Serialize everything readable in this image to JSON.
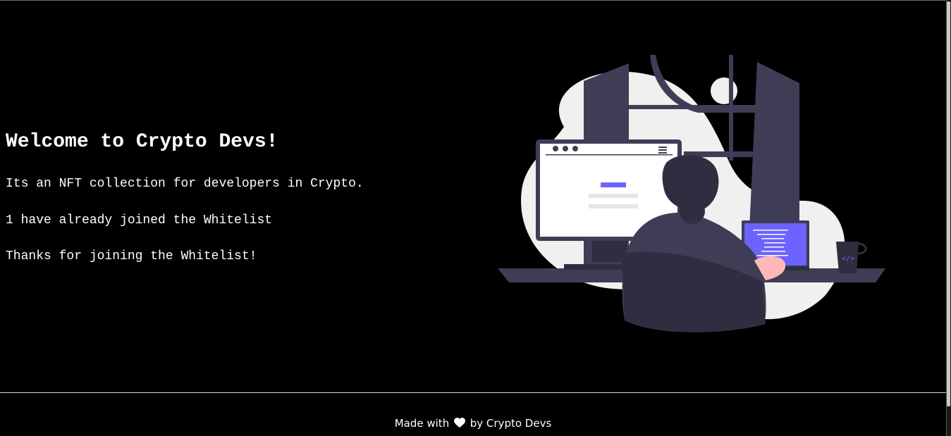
{
  "main": {
    "title": "Welcome to Crypto Devs!",
    "description": "Its an NFT collection for developers in Crypto.",
    "whitelist_count_text": "1 have already joined the Whitelist",
    "status_message": "Thanks for joining the Whitelist!"
  },
  "illustration": {
    "icon": "developer-at-desk-illustration",
    "accent_color": "#6c63ff",
    "dark_color": "#3f3d56"
  },
  "footer": {
    "prefix": "Made with",
    "heart_icon": "heart-icon",
    "suffix": "by Crypto Devs"
  },
  "colors": {
    "background": "#000000",
    "text": "#ffffff"
  }
}
